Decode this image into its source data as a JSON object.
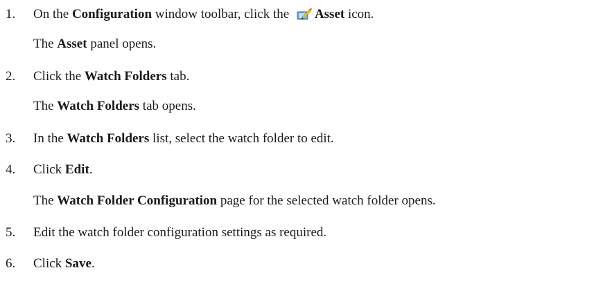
{
  "steps": [
    {
      "number": "1.",
      "pre": "On the ",
      "bold1": "Configuration",
      "mid": " window toolbar, click the ",
      "icon": "asset-icon",
      "bold2": "Asset",
      "post": " icon.",
      "result": {
        "bold": "Asset",
        "post": " panel opens."
      }
    },
    {
      "number": "2.",
      "pre": "Click the ",
      "bold1": "Watch Folders",
      "post": " tab.",
      "result": {
        "pre": "The ",
        "bold": "Watch Folders",
        "post": " tab opens."
      }
    },
    {
      "number": "3.",
      "pre": "In the ",
      "bold1": "Watch Folders",
      "post": " list, select the watch folder to edit."
    },
    {
      "number": "4.",
      "pre": "Click ",
      "bold1": "Edit",
      "post": ".",
      "result": {
        "pre": "The ",
        "bold": "Watch Folder Configuration",
        "post": " page for the selected watch folder opens."
      }
    },
    {
      "number": "5.",
      "pre": "Edit the watch folder configuration settings as required."
    },
    {
      "number": "6.",
      "pre": "Click ",
      "bold1": "Save",
      "post": "."
    }
  ],
  "result_prefix_step1": "The "
}
